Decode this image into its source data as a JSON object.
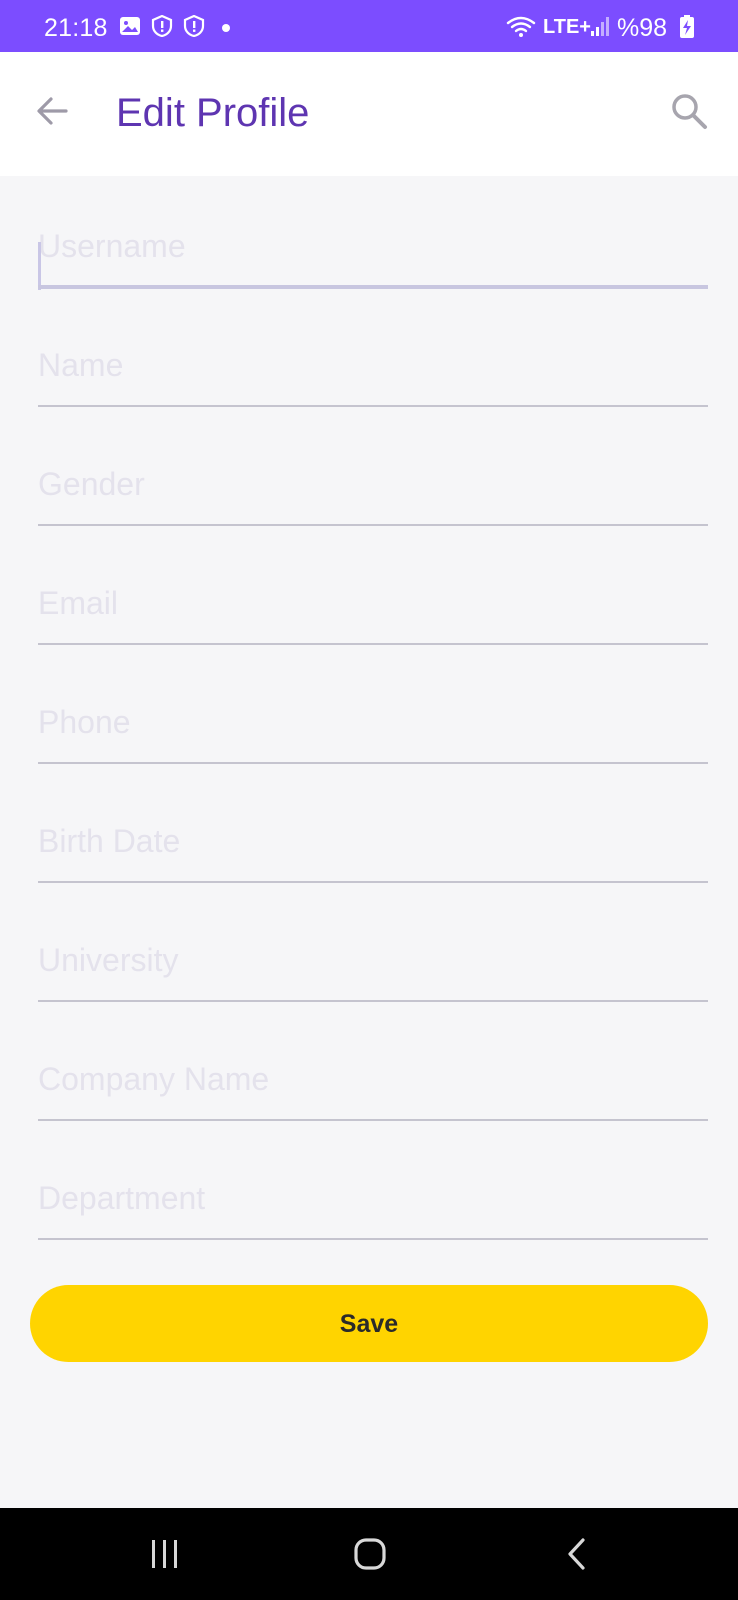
{
  "status_bar": {
    "time": "21:18",
    "network": "LTE+",
    "battery": "%98",
    "icons": [
      "image-icon",
      "shield-alert-icon",
      "shield-alert-icon",
      "notification-dot",
      "wifi-icon",
      "signal-icon",
      "battery-charging-icon"
    ],
    "color": "#7c4dff"
  },
  "app_bar": {
    "title": "Edit Profile",
    "back_icon": "arrow-left-icon",
    "search_icon": "search-icon",
    "title_color": "#5e35b1"
  },
  "form": {
    "fields": [
      {
        "placeholder": "Username",
        "value": "",
        "focused": true
      },
      {
        "placeholder": "Name",
        "value": ""
      },
      {
        "placeholder": "Gender",
        "value": ""
      },
      {
        "placeholder": "Email",
        "value": ""
      },
      {
        "placeholder": "Phone",
        "value": ""
      },
      {
        "placeholder": "Birth Date",
        "value": ""
      },
      {
        "placeholder": "University",
        "value": ""
      },
      {
        "placeholder": "Company Name",
        "value": ""
      },
      {
        "placeholder": "Department",
        "value": ""
      }
    ]
  },
  "save_button": {
    "label": "Save",
    "color": "#ffd400"
  },
  "nav_bar": {
    "buttons": [
      "recent-apps-icon",
      "home-icon",
      "back-icon"
    ]
  }
}
